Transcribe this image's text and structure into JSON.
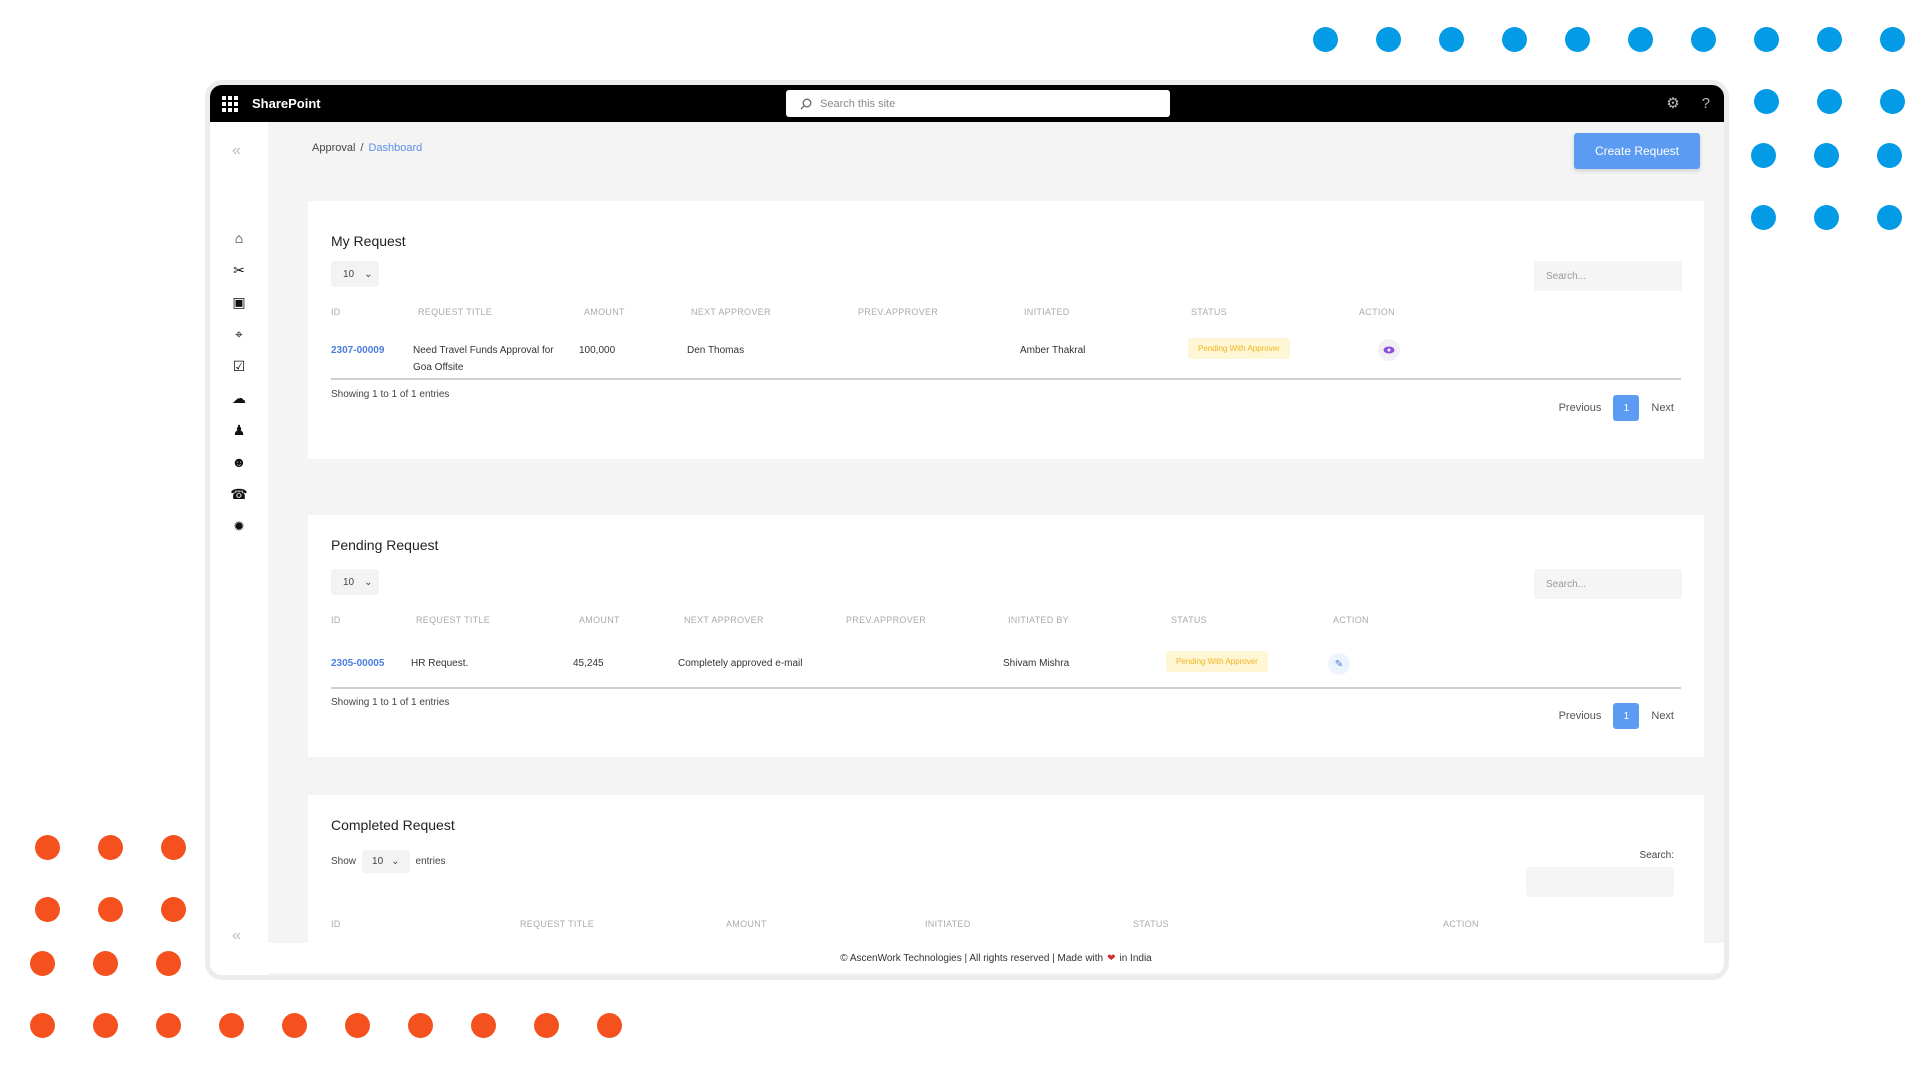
{
  "decor": {
    "blue": "#039be5",
    "orange": "#f4511e"
  },
  "topbar": {
    "brand": "SharePoint",
    "search_placeholder": "Search this site",
    "settings_icon": "gear-icon",
    "help_label": "?"
  },
  "sidebar": {
    "collapse_label": "«",
    "items": [
      {
        "name": "home-icon"
      },
      {
        "name": "tools-icon"
      },
      {
        "name": "id-badge-icon"
      },
      {
        "name": "building-icon"
      },
      {
        "name": "form-icon"
      },
      {
        "name": "weather-icon"
      },
      {
        "name": "team-icon"
      },
      {
        "name": "user-icon"
      },
      {
        "name": "support-icon"
      },
      {
        "name": "settings-icon"
      }
    ]
  },
  "breadcrumb": {
    "root": "Approval",
    "sep": "/",
    "current": "Dashboard"
  },
  "create_button": "Create Request",
  "my_request": {
    "title": "My Request",
    "page_length": "10",
    "search_placeholder": "Search...",
    "headers": [
      "ID",
      "REQUEST TITLE",
      "AMOUNT",
      "NEXT APPROVER",
      "PREV.APPROVER",
      "INITIATED",
      "STATUS",
      "ACTION"
    ],
    "row": {
      "id": "2307-00009",
      "title": "Need Travel Funds Approval for Goa Offsite",
      "amount": "100,000",
      "next_approver": "Den Thomas",
      "prev_approver": "",
      "initiated": "Amber Thakral",
      "status": "Pending With Approver",
      "action_icon": "eye-icon"
    },
    "showing": "Showing 1 to 1 of 1 entries",
    "prev": "Previous",
    "page": "1",
    "next": "Next"
  },
  "pending_request": {
    "title": "Pending Request",
    "page_length": "10",
    "search_placeholder": "Search...",
    "headers": [
      "ID",
      "REQUEST TITLE",
      "AMOUNT",
      "NEXT APPROVER",
      "PREV.APPROVER",
      "INITIATED BY",
      "STATUS",
      "ACTION"
    ],
    "row": {
      "id": "2305-00005",
      "title": "HR Request.",
      "amount": "45,245",
      "next_approver": "Completely approved e-mail",
      "prev_approver": "",
      "initiated_by": "Shivam Mishra",
      "status": "Pending With Approver",
      "action_icon": "pencil-icon"
    },
    "showing": "Showing 1 to 1 of 1 entries",
    "prev": "Previous",
    "page": "1",
    "next": "Next"
  },
  "completed_request": {
    "title": "Completed Request",
    "show_label": "Show",
    "page_length": "10",
    "entries_label": "entries",
    "search_label": "Search:",
    "headers": [
      "ID",
      "REQUEST TITLE",
      "AMOUNT",
      "INITIATED",
      "STATUS",
      "ACTION"
    ]
  },
  "footer": {
    "left": "© AscenWork Technologies | All rights reserved | Made with",
    "heart": "❤",
    "right": "in India"
  }
}
